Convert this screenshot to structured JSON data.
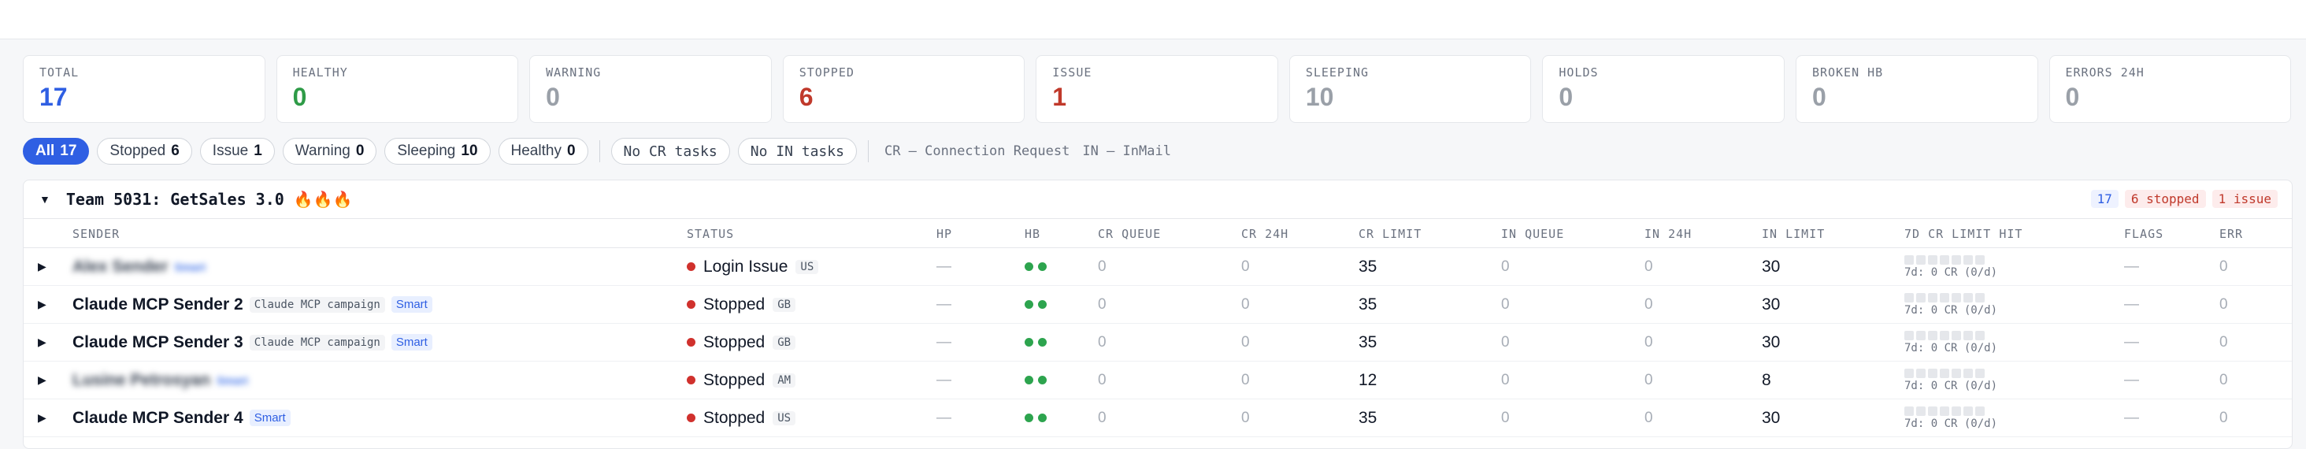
{
  "stats": [
    {
      "label": "TOTAL",
      "value": "17",
      "color": "#2f5fe3"
    },
    {
      "label": "HEALTHY",
      "value": "0",
      "color": "#2e9b47"
    },
    {
      "label": "WARNING",
      "value": "0",
      "color": "#9aa0a8"
    },
    {
      "label": "STOPPED",
      "value": "6",
      "color": "#c0392b"
    },
    {
      "label": "ISSUE",
      "value": "1",
      "color": "#c0392b"
    },
    {
      "label": "SLEEPING",
      "value": "10",
      "color": "#9aa0a8"
    },
    {
      "label": "HOLDS",
      "value": "0",
      "color": "#9aa0a8"
    },
    {
      "label": "BROKEN HB",
      "value": "0",
      "color": "#9aa0a8"
    },
    {
      "label": "ERRORS 24H",
      "value": "0",
      "color": "#9aa0a8"
    }
  ],
  "filters": {
    "all": {
      "label": "All",
      "count": "17"
    },
    "stopped": {
      "label": "Stopped",
      "count": "6"
    },
    "issue": {
      "label": "Issue",
      "count": "1"
    },
    "warning": {
      "label": "Warning",
      "count": "0"
    },
    "sleeping": {
      "label": "Sleeping",
      "count": "10"
    },
    "healthy": {
      "label": "Healthy",
      "count": "0"
    },
    "no_cr": "No CR tasks",
    "no_in": "No IN tasks",
    "legend_cr": "CR — Connection Request",
    "legend_in": "IN — InMail"
  },
  "team": {
    "title": "Team 5031: GetSales 3.0 🔥🔥🔥",
    "badge_total": "17",
    "badge_stopped": "6 stopped",
    "badge_issue": "1 issue"
  },
  "columns": {
    "sender": "SENDER",
    "status": "STATUS",
    "hp": "HP",
    "hb": "HB",
    "cr_queue": "CR QUEUE",
    "cr_24h": "CR 24H",
    "cr_limit": "CR LIMIT",
    "in_queue": "IN QUEUE",
    "in_24h": "IN 24H",
    "in_limit": "IN LIMIT",
    "hit": "7D CR LIMIT HIT",
    "flags": "FLAGS",
    "err": "ERR"
  },
  "rows": [
    {
      "name": "Alex Sender",
      "blurred": true,
      "blur_tag": "Smart",
      "campaign": "",
      "smart": "",
      "status": "Login Issue",
      "country": "US",
      "hp": "—",
      "cr_queue": "0",
      "cr_24h": "0",
      "cr_limit": "35",
      "in_queue": "0",
      "in_24h": "0",
      "in_limit": "30",
      "hit": "7d: 0 CR (0/d)",
      "flags": "—",
      "err": "0"
    },
    {
      "name": "Claude MCP Sender 2",
      "blurred": false,
      "campaign": "Claude MCP campaign",
      "smart": "Smart",
      "status": "Stopped",
      "country": "GB",
      "hp": "—",
      "cr_queue": "0",
      "cr_24h": "0",
      "cr_limit": "35",
      "in_queue": "0",
      "in_24h": "0",
      "in_limit": "30",
      "hit": "7d: 0 CR (0/d)",
      "flags": "—",
      "err": "0"
    },
    {
      "name": "Claude MCP Sender 3",
      "blurred": false,
      "campaign": "Claude MCP campaign",
      "smart": "Smart",
      "status": "Stopped",
      "country": "GB",
      "hp": "—",
      "cr_queue": "0",
      "cr_24h": "0",
      "cr_limit": "35",
      "in_queue": "0",
      "in_24h": "0",
      "in_limit": "30",
      "hit": "7d: 0 CR (0/d)",
      "flags": "—",
      "err": "0"
    },
    {
      "name": "Lusine Petrosyan",
      "blurred": true,
      "blur_tag": "Smart",
      "campaign": "",
      "smart": "",
      "status": "Stopped",
      "country": "AM",
      "hp": "—",
      "cr_queue": "0",
      "cr_24h": "0",
      "cr_limit": "12",
      "in_queue": "0",
      "in_24h": "0",
      "in_limit": "8",
      "hit": "7d: 0 CR (0/d)",
      "flags": "—",
      "err": "0"
    },
    {
      "name": "Claude MCP Sender 4",
      "blurred": false,
      "campaign": "",
      "smart": "Smart",
      "status": "Stopped",
      "country": "US",
      "hp": "—",
      "cr_queue": "0",
      "cr_24h": "0",
      "cr_limit": "35",
      "in_queue": "0",
      "in_24h": "0",
      "in_limit": "30",
      "hit": "7d: 0 CR (0/d)",
      "flags": "—",
      "err": "0"
    }
  ],
  "icons": {
    "expand": "caret-right-icon",
    "collapse": "caret-down-icon"
  }
}
